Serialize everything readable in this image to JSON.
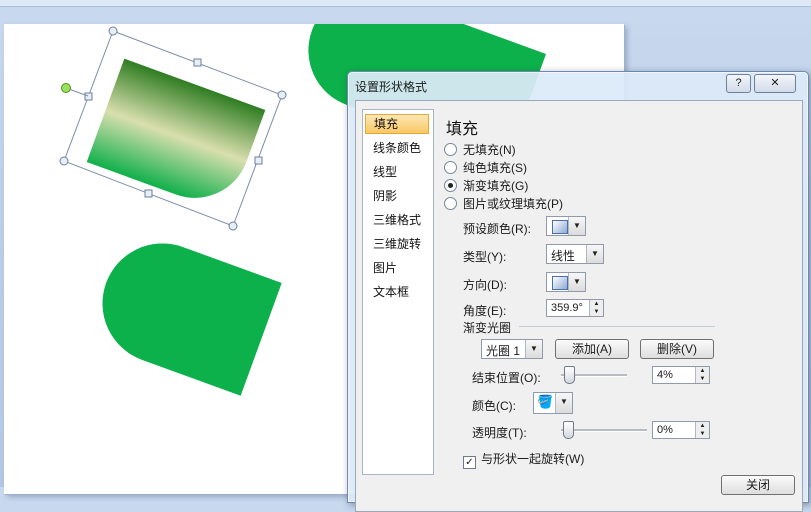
{
  "dialog": {
    "title": "设置形状格式",
    "help_label": "?",
    "close_label": "✕",
    "nav": [
      "填充",
      "线条颜色",
      "线型",
      "阴影",
      "三维格式",
      "三维旋转",
      "图片",
      "文本框"
    ],
    "section_title": "填充",
    "fill_options": [
      "无填充(N)",
      "纯色填充(S)",
      "渐变填充(G)",
      "图片或纹理填充(P)"
    ],
    "selected_fill": 2,
    "preset_color_label": "预设颜色(R):",
    "type_label": "类型(Y):",
    "type_value": "线性",
    "direction_label": "方向(D):",
    "angle_label": "角度(E):",
    "angle_value": "359.9°",
    "stops_heading": "渐变光圈",
    "stop_select": "光圈 1",
    "add_button": "添加(A)",
    "delete_button": "删除(V)",
    "end_position_label": "结束位置(O):",
    "end_position_value": "4%",
    "end_position_fraction": 0.04,
    "color_label": "颜色(C):",
    "transparency_label": "透明度(T):",
    "transparency_value": "0%",
    "rotate_with_shape": "与形状一起旋转(W)",
    "rotate_checked": true,
    "close_button": "关闭"
  },
  "colors": {
    "shape_green": "#0db14b",
    "gradient_dark": "#3a8a2d",
    "gradient_light": "#d8e0a8",
    "dialog_bg": "#dce9f9",
    "nav_selected": "#f9c864"
  }
}
